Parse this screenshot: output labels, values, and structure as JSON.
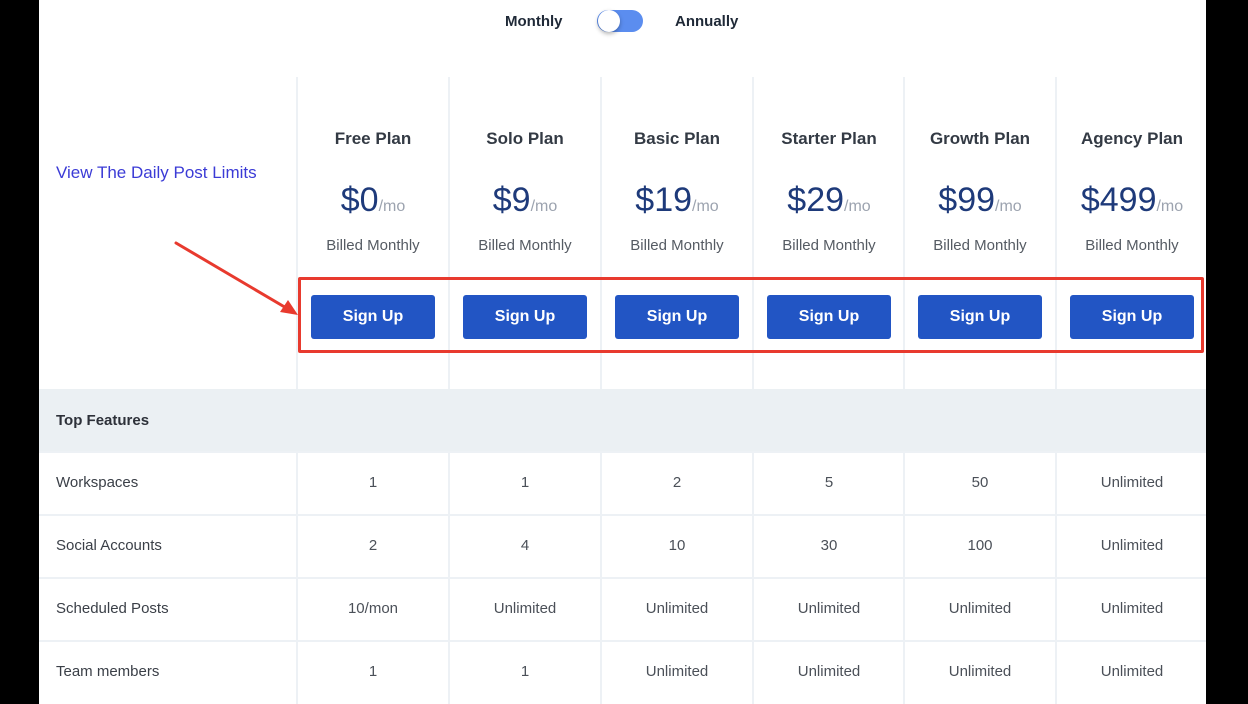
{
  "billing_toggle": {
    "left_label": "Monthly",
    "right_label": "Annually",
    "state": "monthly"
  },
  "side_link": "View The Daily Post Limits",
  "plans": [
    {
      "name": "Free Plan",
      "price": "$0",
      "per": "/mo",
      "billed": "Billed Monthly",
      "cta": "Sign Up"
    },
    {
      "name": "Solo Plan",
      "price": "$9",
      "per": "/mo",
      "billed": "Billed Monthly",
      "cta": "Sign Up"
    },
    {
      "name": "Basic Plan",
      "price": "$19",
      "per": "/mo",
      "billed": "Billed Monthly",
      "cta": "Sign Up"
    },
    {
      "name": "Starter Plan",
      "price": "$29",
      "per": "/mo",
      "billed": "Billed Monthly",
      "cta": "Sign Up"
    },
    {
      "name": "Growth Plan",
      "price": "$99",
      "per": "/mo",
      "billed": "Billed Monthly",
      "cta": "Sign Up"
    },
    {
      "name": "Agency Plan",
      "price": "$499",
      "per": "/mo",
      "billed": "Billed Monthly",
      "cta": "Sign Up"
    }
  ],
  "features_section": {
    "title": "Top Features",
    "rows": [
      {
        "label": "Workspaces",
        "values": [
          "1",
          "1",
          "2",
          "5",
          "50",
          "Unlimited"
        ]
      },
      {
        "label": "Social Accounts",
        "values": [
          "2",
          "4",
          "10",
          "30",
          "100",
          "Unlimited"
        ]
      },
      {
        "label": "Scheduled Posts",
        "values": [
          "10/mon",
          "Unlimited",
          "Unlimited",
          "Unlimited",
          "Unlimited",
          "Unlimited"
        ]
      },
      {
        "label": "Team members",
        "values": [
          "1",
          "1",
          "Unlimited",
          "Unlimited",
          "Unlimited",
          "Unlimited"
        ]
      }
    ]
  },
  "colors": {
    "accent": "#2255c4",
    "toggle": "#5b8def",
    "link": "#3b3bd6",
    "price": "#1e3a7a",
    "annotation": "#e83a2e",
    "band": "#ebf0f3"
  }
}
